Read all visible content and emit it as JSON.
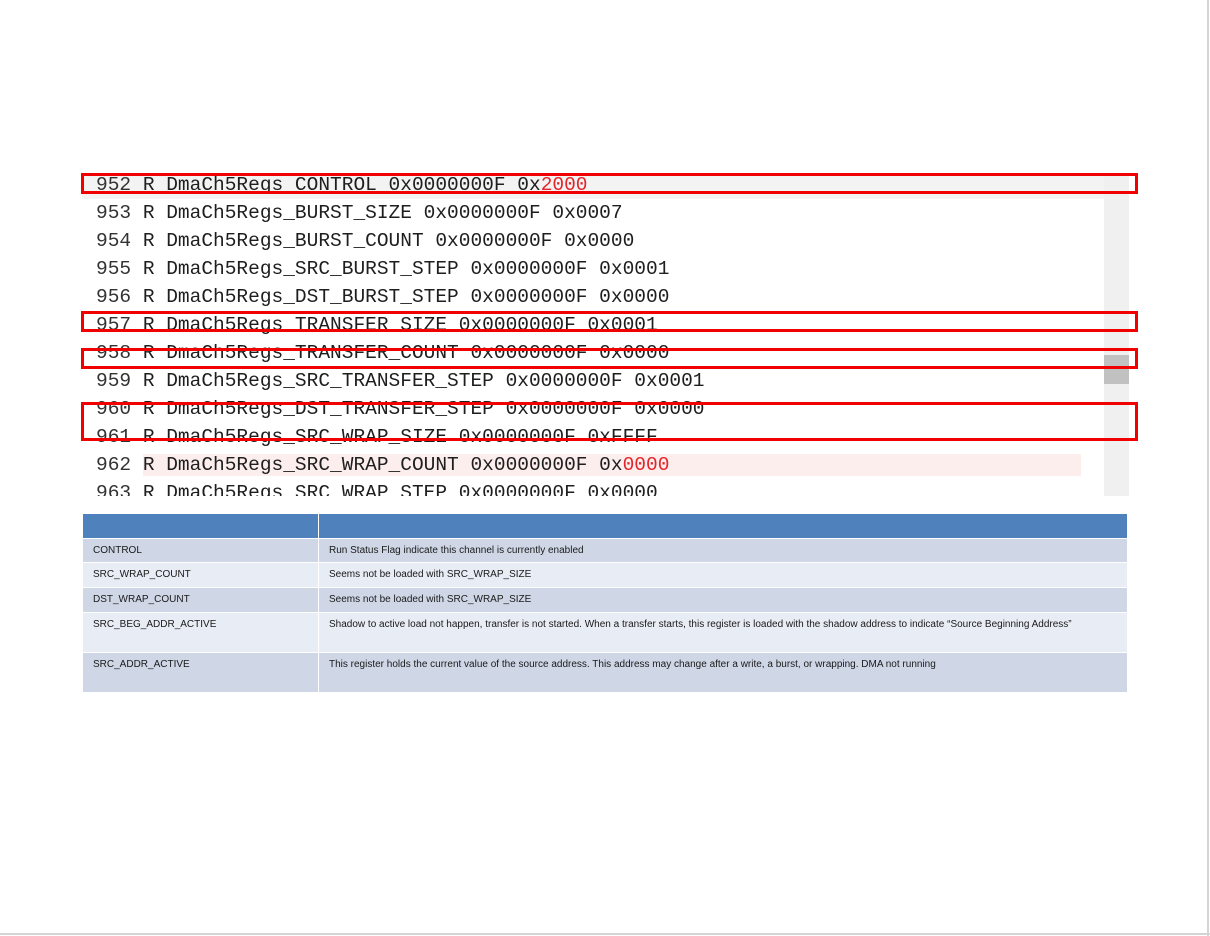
{
  "code_lines": [
    {
      "ln": "952",
      "text": "R DmaCh5Regs_CONTROL 0x0000000F 0x",
      "tail": "2000",
      "tail_red": true
    },
    {
      "ln": "953",
      "text": "R DmaCh5Regs_BURST_SIZE 0x0000000F 0x0007",
      "tail": "",
      "tail_red": false
    },
    {
      "ln": "954",
      "text": "R DmaCh5Regs_BURST_COUNT 0x0000000F 0x0000",
      "tail": "",
      "tail_red": false
    },
    {
      "ln": "955",
      "text": "R DmaCh5Regs_SRC_BURST_STEP 0x0000000F 0x0001",
      "tail": "",
      "tail_red": false
    },
    {
      "ln": "956",
      "text": "R DmaCh5Regs_DST_BURST_STEP 0x0000000F 0x0000",
      "tail": "",
      "tail_red": false
    },
    {
      "ln": "957",
      "text": "R DmaCh5Regs_TRANSFER_SIZE 0x0000000F 0x0001",
      "tail": "",
      "tail_red": false
    },
    {
      "ln": "958",
      "text": "R DmaCh5Regs_TRANSFER_COUNT 0x0000000F 0x0000",
      "tail": "",
      "tail_red": false
    },
    {
      "ln": "959",
      "text": "R DmaCh5Regs_SRC_TRANSFER_STEP 0x0000000F 0x0001",
      "tail": "",
      "tail_red": false
    },
    {
      "ln": "960",
      "text": "R DmaCh5Regs_DST_TRANSFER_STEP 0x0000000F 0x0000",
      "tail": "",
      "tail_red": false
    },
    {
      "ln": "961",
      "text": "R DmaCh5Regs_SRC_WRAP_SIZE 0x0000000F 0xFFFF",
      "tail": "",
      "tail_red": false
    },
    {
      "ln": "962",
      "text": "R DmaCh5Regs_SRC_WRAP_COUNT 0x0000000F 0x",
      "tail": "0000",
      "tail_red": true
    },
    {
      "ln": "963",
      "text": "R DmaCh5Regs_SRC_WRAP_STEP 0x0000000F 0x0000",
      "tail": "",
      "tail_red": false
    }
  ],
  "highlight_color": "#f00000",
  "table": {
    "header_color": "#4f81bd",
    "rows": [
      {
        "register": "CONTROL",
        "note": "Run Status Flag indicate this channel is currently enabled"
      },
      {
        "register": "SRC_WRAP_COUNT",
        "note": "Seems not be loaded with SRC_WRAP_SIZE"
      },
      {
        "register": "DST_WRAP_COUNT",
        "note": "Seems not be loaded with SRC_WRAP_SIZE"
      },
      {
        "register": "SRC_BEG_ADDR_ACTIVE",
        "note": "Shadow to active load not happen, transfer is not started. When a transfer starts, this register is loaded with the shadow address to indicate “Source Beginning Address”"
      },
      {
        "register": "SRC_ADDR_ACTIVE",
        "note": "This register holds the current value of the source address. This address may change after a write, a burst, or wrapping. DMA not running"
      }
    ]
  }
}
